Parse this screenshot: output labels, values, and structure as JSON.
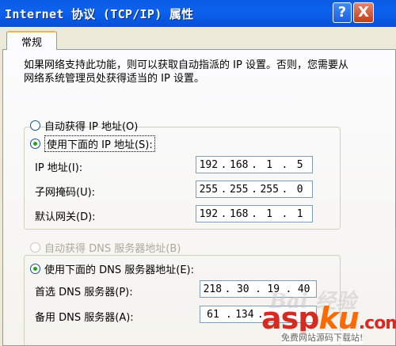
{
  "window": {
    "title": "Internet 协议 (TCP/IP) 属性",
    "help_label": "?",
    "close_label": "X"
  },
  "tabs": [
    {
      "label": "常规",
      "active": true
    }
  ],
  "description": "如果网络支持此功能，则可以获取自动指派的 IP 设置。否则，您需要从网络系统管理员处获得适当的 IP 设置。",
  "ip_section": {
    "auto_label": "自动获得 IP 地址(O)",
    "auto_selected": false,
    "manual_label": "使用下面的 IP 地址(S):",
    "manual_selected": true,
    "fields": [
      {
        "label": "IP 地址(I):",
        "segments": [
          "192",
          "168",
          "1",
          "5"
        ]
      },
      {
        "label": "子网掩码(U):",
        "segments": [
          "255",
          "255",
          "255",
          "0"
        ]
      },
      {
        "label": "默认网关(D):",
        "segments": [
          "192",
          "168",
          "1",
          "1"
        ]
      }
    ]
  },
  "dns_section": {
    "auto_label": "自动获得 DNS 服务器地址(B)",
    "auto_disabled": true,
    "manual_label": "使用下面的 DNS 服务器地址(E):",
    "manual_selected": true,
    "fields": [
      {
        "label": "首选 DNS 服务器(P):",
        "segments": [
          "218",
          "30",
          "19",
          "40"
        ]
      },
      {
        "label": "备用 DNS 服务器(A):",
        "segments": [
          "61",
          "134",
          "",
          ""
        ]
      }
    ]
  },
  "watermark": {
    "baidu": "Bai 经验",
    "asp": "asp",
    "ku": "ku",
    "com": ".com",
    "sub": "免费网站源码下载站!"
  },
  "colors": {
    "titlebar": "#0c62ef",
    "radio_dot": "#21a121",
    "watermark_red": "#d62b20",
    "watermark_orange": "#ff6a00"
  }
}
